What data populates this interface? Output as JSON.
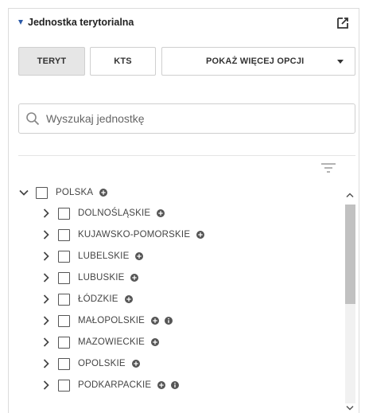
{
  "panel": {
    "title": "Jednostka terytorialna",
    "collapse_icon": "caret-down-icon",
    "external_icon": "open-external-icon"
  },
  "buttons": {
    "teryt": "TERYT",
    "kts": "KTS",
    "more": "POKAŻ WIĘCEJ OPCJI"
  },
  "search": {
    "placeholder": "Wyszukaj jednostkę",
    "value": "",
    "icon": "search-icon"
  },
  "filter_icon": "filter-icon",
  "tree": {
    "root": {
      "label": "POLSKA",
      "expanded": true
    },
    "children": [
      {
        "label": "DOLNOŚLĄSKIE",
        "info": false
      },
      {
        "label": "KUJAWSKO-POMORSKIE",
        "info": false
      },
      {
        "label": "LUBELSKIE",
        "info": false
      },
      {
        "label": "LUBUSKIE",
        "info": false
      },
      {
        "label": "ŁÓDZKIE",
        "info": false
      },
      {
        "label": "MAŁOPOLSKIE",
        "info": true
      },
      {
        "label": "MAZOWIECKIE",
        "info": false
      },
      {
        "label": "OPOLSKIE",
        "info": false
      },
      {
        "label": "PODKARPACKIE",
        "info": true
      }
    ]
  },
  "colors": {
    "accent": "#2b5aa8",
    "icon": "#555555",
    "border": "#cfcfcf",
    "active_button": "#e6e6e6"
  }
}
